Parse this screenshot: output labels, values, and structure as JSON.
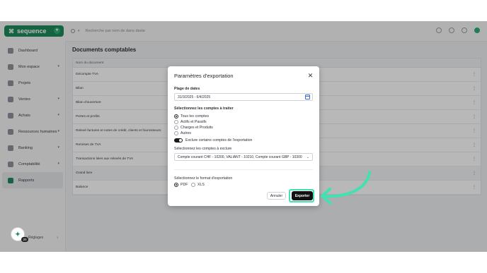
{
  "brand": {
    "name": "sequence"
  },
  "sidebar": {
    "items": [
      {
        "label": "Dashboard",
        "icon": "dashboard-icon",
        "has_arrow": false
      },
      {
        "label": "Mon espace",
        "icon": "user-icon",
        "has_arrow": true
      },
      {
        "label": "Projets",
        "icon": "folder-icon",
        "has_arrow": false
      },
      {
        "label": "Ventes",
        "icon": "cart-icon",
        "has_arrow": true
      },
      {
        "label": "Achats",
        "icon": "bag-icon",
        "has_arrow": true
      },
      {
        "label": "Ressources humaines",
        "icon": "people-icon",
        "has_arrow": true
      },
      {
        "label": "Banking",
        "icon": "bank-icon",
        "has_arrow": true
      },
      {
        "label": "Comptabilité",
        "icon": "ledger-icon",
        "has_arrow": true
      },
      {
        "label": "Rapports",
        "icon": "chart-icon",
        "has_arrow": false,
        "active": true
      }
    ],
    "bottom_label": "Réglages",
    "help_badge": "20"
  },
  "topbar": {
    "search_placeholder": "Recherche par nom de dans daste"
  },
  "main": {
    "title": "Documents comptables",
    "table_header": "Nom du document",
    "rows": [
      "Décompte TVA",
      "Bilan",
      "Bilan d'ouverture",
      "Pertes et profits",
      "Relevé factures et notes de crédit, clients et fournisseurs",
      "Remises de TVA",
      "Transactions liées aux relevés de TVA",
      "Grand livre",
      "Balance"
    ]
  },
  "modal": {
    "title": "Paramètres d'exportation",
    "date_range_label": "Plage de dates",
    "date_range_value": "31/3/2025 - 6/4/2025",
    "accounts_label": "Sélectionnez les comptes à traiter",
    "account_options": [
      "Tous les comptes",
      "Actifs et Passifs",
      "Charges et Produits",
      "Autres"
    ],
    "selected_account_index": 0,
    "exclude_toggle_label": "Exclure certains comptes de l'exportation",
    "exclude_toggle_on": true,
    "exclude_select_label": "Sélectionnez les comptes à exclure",
    "exclude_select_value": "Compte courant CHF - 10200, VALIANT - 10210, Compte courant GBP - 10300",
    "format_label": "Sélectionnez le format d'exportation",
    "format_options": [
      "PDF",
      "XLS"
    ],
    "selected_format_index": 0,
    "cancel_label": "Annuler",
    "export_label": "Exporter"
  },
  "colors": {
    "brand_green": "#1f8a5c",
    "highlight_teal": "#43e0b2",
    "export_button": "#111111"
  }
}
